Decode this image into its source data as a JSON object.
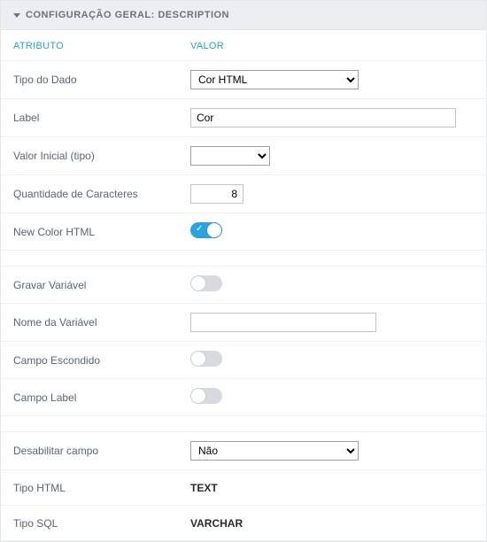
{
  "panel": {
    "title": "CONFIGURAÇÃO GERAL: DESCRIPTION",
    "columns": {
      "attr": "ATRIBUTO",
      "val": "VALOR"
    }
  },
  "fields": {
    "tipo_dado": {
      "label": "Tipo do Dado",
      "value": "Cor HTML"
    },
    "label": {
      "label": "Label",
      "value": "Cor"
    },
    "valor_inicial": {
      "label": "Valor Inicial (tipo)",
      "value": ""
    },
    "qtd_caracteres": {
      "label": "Quantidade de Caracteres",
      "value": "8"
    },
    "new_color": {
      "label": "New Color HTML",
      "on": true
    },
    "gravar_var": {
      "label": "Gravar Variável",
      "on": false
    },
    "nome_var": {
      "label": "Nome da Variável",
      "value": ""
    },
    "campo_escondido": {
      "label": "Campo Escondido",
      "on": false
    },
    "campo_label": {
      "label": "Campo Label",
      "on": false
    },
    "desabilitar": {
      "label": "Desabilitar campo",
      "value": "Não"
    },
    "tipo_html": {
      "label": "Tipo HTML",
      "value": "TEXT"
    },
    "tipo_sql": {
      "label": "Tipo SQL",
      "value": "VARCHAR"
    }
  }
}
